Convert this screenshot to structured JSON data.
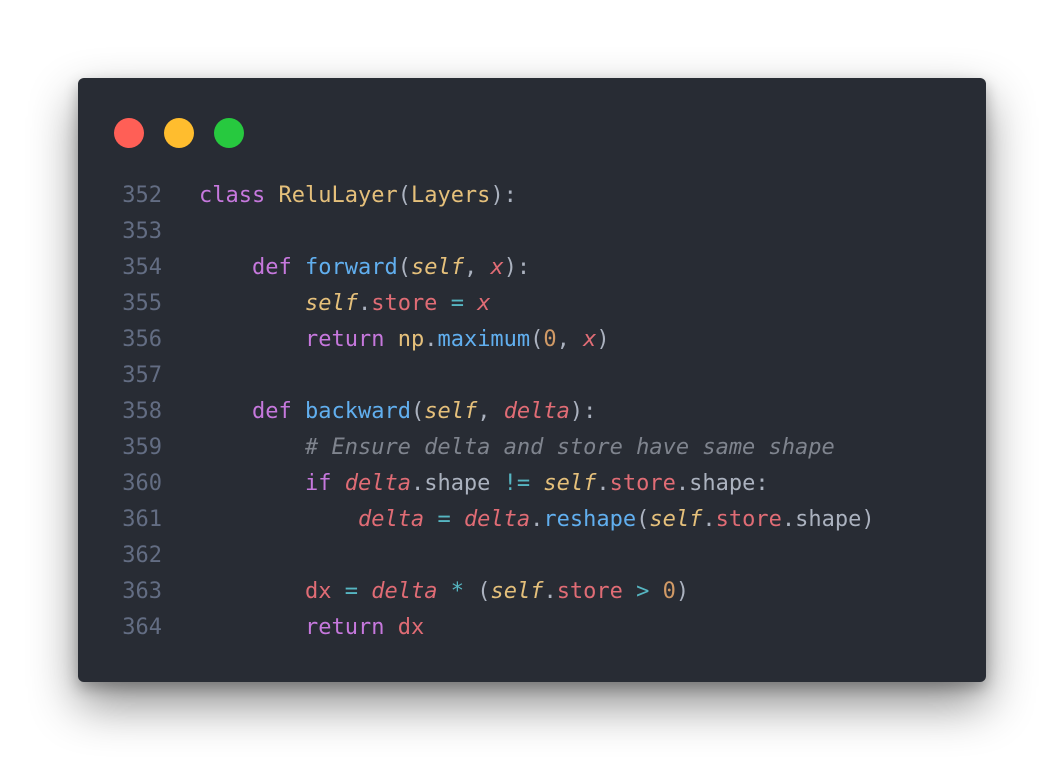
{
  "window": {
    "traffic_lights": {
      "close_color": "#ff5f56",
      "minimize_color": "#ffbd2e",
      "maximize_color": "#27c93f"
    }
  },
  "code": {
    "lines": [
      {
        "number": "352",
        "tokens": [
          {
            "t": "class",
            "c": "kw"
          },
          {
            "t": " ",
            "c": "plain"
          },
          {
            "t": "ReluLayer",
            "c": "cls"
          },
          {
            "t": "(",
            "c": "plain"
          },
          {
            "t": "Layers",
            "c": "cls"
          },
          {
            "t": "):",
            "c": "plain"
          }
        ]
      },
      {
        "number": "353",
        "tokens": []
      },
      {
        "number": "354",
        "tokens": [
          {
            "t": "    ",
            "c": "plain"
          },
          {
            "t": "def",
            "c": "kw"
          },
          {
            "t": " ",
            "c": "plain"
          },
          {
            "t": "forward",
            "c": "fn"
          },
          {
            "t": "(",
            "c": "plain"
          },
          {
            "t": "self",
            "c": "selfv"
          },
          {
            "t": ", ",
            "c": "plain"
          },
          {
            "t": "x",
            "c": "param"
          },
          {
            "t": "):",
            "c": "plain"
          }
        ]
      },
      {
        "number": "355",
        "tokens": [
          {
            "t": "        ",
            "c": "plain"
          },
          {
            "t": "self",
            "c": "selfv"
          },
          {
            "t": ".",
            "c": "plain"
          },
          {
            "t": "store",
            "c": "prop"
          },
          {
            "t": " ",
            "c": "plain"
          },
          {
            "t": "=",
            "c": "op"
          },
          {
            "t": " ",
            "c": "plain"
          },
          {
            "t": "x",
            "c": "param"
          }
        ]
      },
      {
        "number": "356",
        "tokens": [
          {
            "t": "        ",
            "c": "plain"
          },
          {
            "t": "return",
            "c": "kw"
          },
          {
            "t": " ",
            "c": "plain"
          },
          {
            "t": "np",
            "c": "cls"
          },
          {
            "t": ".",
            "c": "plain"
          },
          {
            "t": "maximum",
            "c": "fn"
          },
          {
            "t": "(",
            "c": "plain"
          },
          {
            "t": "0",
            "c": "num"
          },
          {
            "t": ", ",
            "c": "plain"
          },
          {
            "t": "x",
            "c": "param"
          },
          {
            "t": ")",
            "c": "plain"
          }
        ]
      },
      {
        "number": "357",
        "tokens": []
      },
      {
        "number": "358",
        "tokens": [
          {
            "t": "    ",
            "c": "plain"
          },
          {
            "t": "def",
            "c": "kw"
          },
          {
            "t": " ",
            "c": "plain"
          },
          {
            "t": "backward",
            "c": "fn"
          },
          {
            "t": "(",
            "c": "plain"
          },
          {
            "t": "self",
            "c": "selfv"
          },
          {
            "t": ", ",
            "c": "plain"
          },
          {
            "t": "delta",
            "c": "param"
          },
          {
            "t": "):",
            "c": "plain"
          }
        ]
      },
      {
        "number": "359",
        "tokens": [
          {
            "t": "        ",
            "c": "plain"
          },
          {
            "t": "# Ensure delta and store have same shape",
            "c": "cmt"
          }
        ]
      },
      {
        "number": "360",
        "tokens": [
          {
            "t": "        ",
            "c": "plain"
          },
          {
            "t": "if",
            "c": "kw"
          },
          {
            "t": " ",
            "c": "plain"
          },
          {
            "t": "delta",
            "c": "param"
          },
          {
            "t": ".shape ",
            "c": "plain"
          },
          {
            "t": "!=",
            "c": "op"
          },
          {
            "t": " ",
            "c": "plain"
          },
          {
            "t": "self",
            "c": "selfv"
          },
          {
            "t": ".",
            "c": "plain"
          },
          {
            "t": "store",
            "c": "prop"
          },
          {
            "t": ".shape:",
            "c": "plain"
          }
        ]
      },
      {
        "number": "361",
        "tokens": [
          {
            "t": "            ",
            "c": "plain"
          },
          {
            "t": "delta",
            "c": "param"
          },
          {
            "t": " ",
            "c": "plain"
          },
          {
            "t": "=",
            "c": "op"
          },
          {
            "t": " ",
            "c": "plain"
          },
          {
            "t": "delta",
            "c": "param"
          },
          {
            "t": ".",
            "c": "plain"
          },
          {
            "t": "reshape",
            "c": "fn"
          },
          {
            "t": "(",
            "c": "plain"
          },
          {
            "t": "self",
            "c": "selfv"
          },
          {
            "t": ".",
            "c": "plain"
          },
          {
            "t": "store",
            "c": "prop"
          },
          {
            "t": ".shape)",
            "c": "plain"
          }
        ]
      },
      {
        "number": "362",
        "tokens": []
      },
      {
        "number": "363",
        "tokens": [
          {
            "t": "        ",
            "c": "plain"
          },
          {
            "t": "dx",
            "c": "var"
          },
          {
            "t": " ",
            "c": "plain"
          },
          {
            "t": "=",
            "c": "op"
          },
          {
            "t": " ",
            "c": "plain"
          },
          {
            "t": "delta",
            "c": "param"
          },
          {
            "t": " ",
            "c": "plain"
          },
          {
            "t": "*",
            "c": "op"
          },
          {
            "t": " (",
            "c": "plain"
          },
          {
            "t": "self",
            "c": "selfv"
          },
          {
            "t": ".",
            "c": "plain"
          },
          {
            "t": "store",
            "c": "prop"
          },
          {
            "t": " ",
            "c": "plain"
          },
          {
            "t": ">",
            "c": "op"
          },
          {
            "t": " ",
            "c": "plain"
          },
          {
            "t": "0",
            "c": "num"
          },
          {
            "t": ")",
            "c": "plain"
          }
        ]
      },
      {
        "number": "364",
        "tokens": [
          {
            "t": "        ",
            "c": "plain"
          },
          {
            "t": "return",
            "c": "kw"
          },
          {
            "t": " ",
            "c": "plain"
          },
          {
            "t": "dx",
            "c": "var"
          }
        ]
      }
    ]
  }
}
